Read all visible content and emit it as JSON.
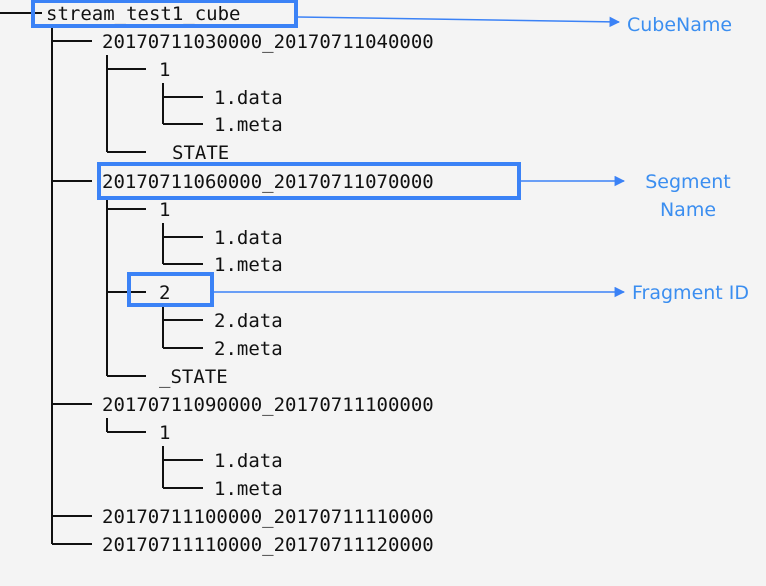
{
  "colors": {
    "accent": "#3b82f6",
    "annotation_text": "#3b8ef0",
    "tree_text": "#111111",
    "tree_lines": "#111111",
    "background": "#f4f4f4"
  },
  "tree": {
    "root": "stream_test1_cube",
    "segment1": {
      "name": "20170711030000_20170711040000",
      "fragment1": {
        "id": "1",
        "data": "1.data",
        "meta": "1.meta"
      },
      "state": "STATE"
    },
    "segment2": {
      "name": "20170711060000_20170711070000",
      "fragment1": {
        "id": "1",
        "data": "1.data",
        "meta": "1.meta"
      },
      "fragment2": {
        "id": "2",
        "data": "2.data",
        "meta": "2.meta"
      },
      "state": "_STATE"
    },
    "segment3": {
      "name": "20170711090000_20170711100000",
      "fragment1": {
        "id": "1",
        "data": "1.data",
        "meta": "1.meta"
      }
    },
    "segment4": {
      "name": "20170711100000_20170711110000"
    },
    "segment5": {
      "name": "20170711110000_20170711120000"
    }
  },
  "annotations": {
    "cube": "CubeName",
    "segment_line1": "Segment",
    "segment_line2": "Name",
    "fragment": "Fragment ID"
  }
}
